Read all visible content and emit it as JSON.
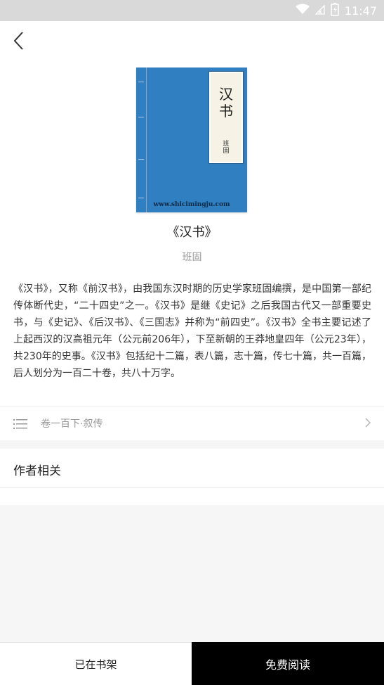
{
  "status_bar": {
    "time": "11:47",
    "icons": [
      "wifi-icon",
      "signal-icon",
      "battery-icon"
    ]
  },
  "header": {
    "back_icon": "back-arrow-icon"
  },
  "book": {
    "cover": {
      "title": "汉书",
      "author": "班固",
      "site": "www.shicimingju.com",
      "color": "#2f7fc1"
    },
    "title": "《汉书》",
    "author": "班固",
    "description": "《汉书》，又称《前汉书》，由我国东汉时期的历史学家班固编撰，是中国第一部纪传体断代史，“二十四史”之一。《汉书》是继《史记》之后我国古代又一部重要史书，与《史记》、《后汉书》、《三国志》并称为“前四史”。《汉书》全书主要记述了上起西汉的汉高祖元年（公元前206年），下至新朝的王莽地皇四年（公元23年），共230年的史事。《汉书》包括纪十二篇，表八篇，志十篇，传七十篇，共一百篇，后人划分为一百二十卷，共八十万字。"
  },
  "chapter": {
    "label": "卷一百下·叙传",
    "icon": "list-icon",
    "chevron": "chevron-right-icon"
  },
  "author_section": {
    "title": "作者相关"
  },
  "bottom_bar": {
    "shelf_label": "已在书架",
    "read_label": "免费阅读"
  }
}
